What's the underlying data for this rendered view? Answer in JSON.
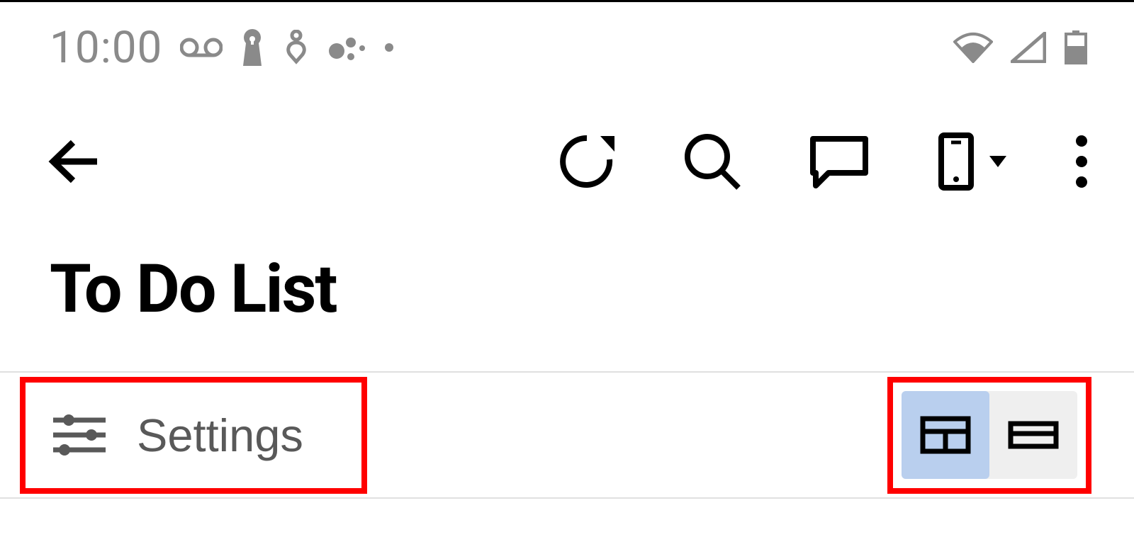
{
  "status_bar": {
    "time": "10:00",
    "icons": {
      "voicemail": "voicemail-icon",
      "lock": "lock-icon",
      "health": "health-icon",
      "assistant": "assistant-icon",
      "dot": "dot-icon",
      "wifi": "wifi-icon",
      "cellular": "cellular-icon",
      "battery": "battery-icon"
    }
  },
  "toolbar": {
    "back": "back-button",
    "refresh": "refresh-button",
    "search": "search-button",
    "comment": "comment-button",
    "device": "device-button",
    "more": "more-button"
  },
  "page": {
    "title": "To Do List"
  },
  "controls": {
    "settings_label": "Settings",
    "view_mode": "detailed"
  }
}
